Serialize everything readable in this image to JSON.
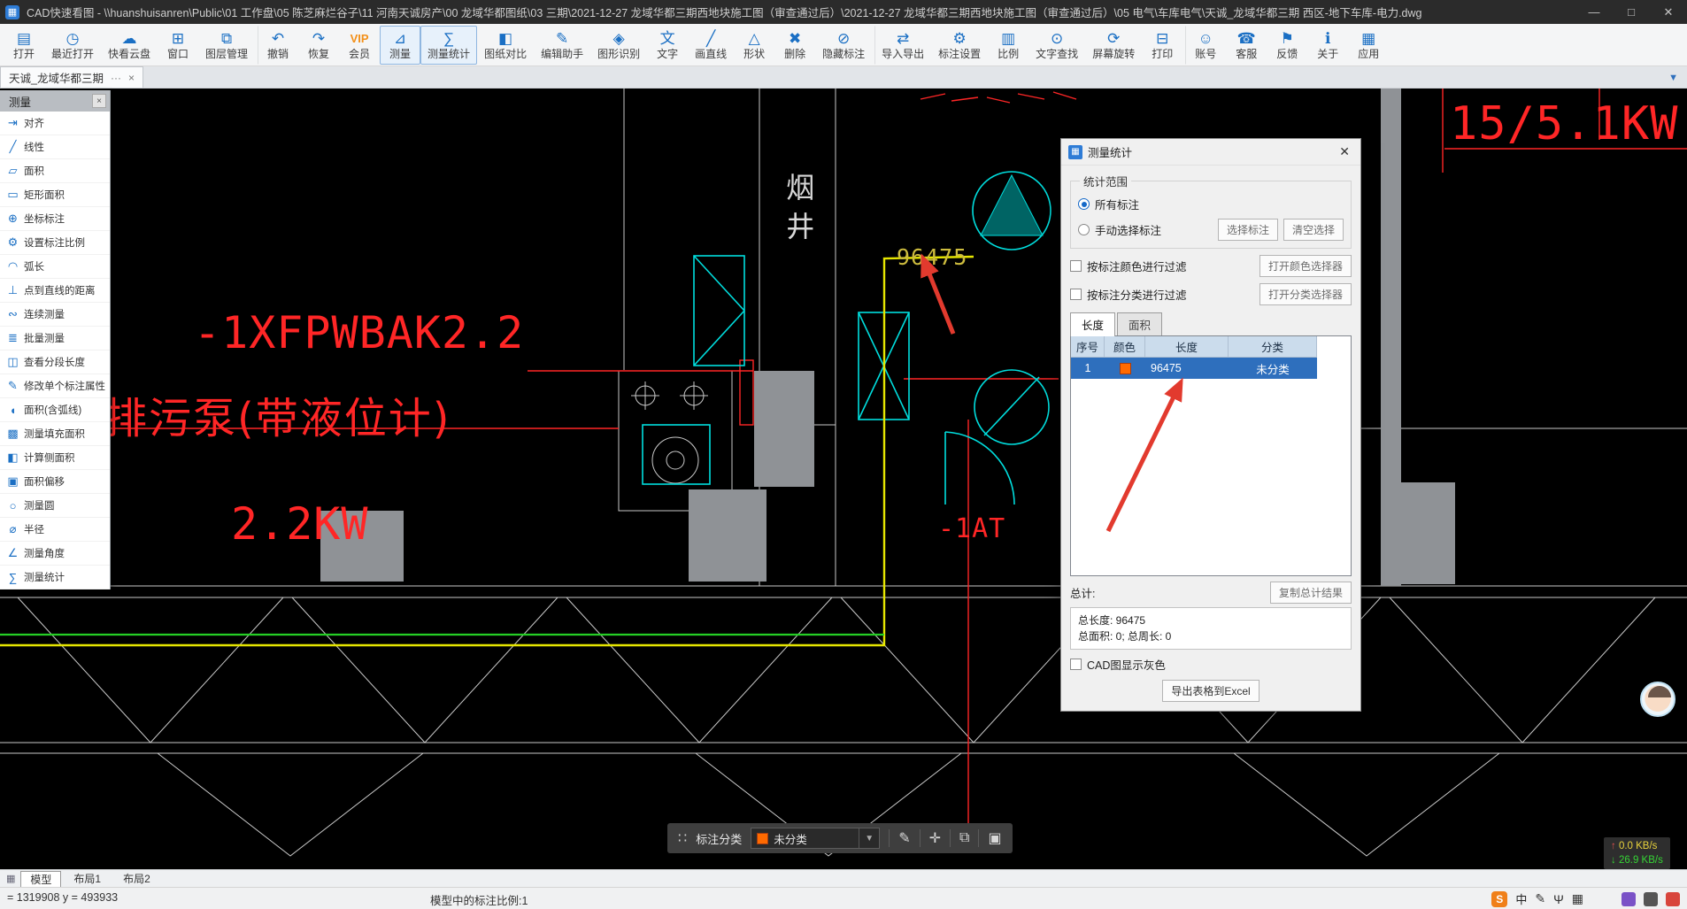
{
  "colors": {
    "titlebar-bg": "#2b2b2b",
    "toolbar-icon": "#1a6fc4",
    "accent": "#2e6fbd",
    "selected-row": "#2e6fbd",
    "swatch-orange": "#ff6a00",
    "cad-red": "#ff2626",
    "cad-cyan": "#00dede",
    "cad-yellow": "#e6e600",
    "cad-gold": "#cdbc3e",
    "cad-green": "#25cf25",
    "cad-white": "#c9c9c9",
    "cad-gray": "#8f9296",
    "arrow-red": "#e23a2e",
    "speed-up": "#e8d23c",
    "speed-down": "#35d435"
  },
  "titlebar": {
    "app_icon": "▦",
    "title": "CAD快速看图 - \\\\huanshuisanren\\Public\\01 工作盘\\05 陈芝麻烂谷子\\11 河南天诚房产\\00 龙域华都图纸\\03 三期\\2021-12-27 龙域华都三期西地块施工图（审查通过后）\\2021-12-27 龙域华都三期西地块施工图（审查通过后）\\05 电气\\车库电气\\天诚_龙域华都三期 西区-地下车库-电力.dwg",
    "minimize_icon": "—",
    "maximize_icon": "□",
    "close_icon": "✕"
  },
  "toolbar": {
    "items": [
      {
        "name": "open-button",
        "icon_name": "folder-open-icon",
        "icon": "▤",
        "label": "打开"
      },
      {
        "name": "recent-open-button",
        "icon_name": "recent-clock-icon",
        "icon": "◷",
        "label": "最近打开"
      },
      {
        "name": "cloud-drive-button",
        "icon_name": "cloud-icon",
        "icon": "☁",
        "label": "快看云盘"
      },
      {
        "name": "window-button",
        "icon_name": "window-icon",
        "icon": "⊞",
        "label": "窗口"
      },
      {
        "name": "layer-manager-button",
        "icon_name": "layers-icon",
        "icon": "⧉",
        "label": "图层管理"
      },
      {
        "name": "undo-button",
        "icon_name": "undo-icon",
        "icon": "↶",
        "label": "撤销",
        "sep": true
      },
      {
        "name": "redo-button",
        "icon_name": "redo-icon",
        "icon": "↷",
        "label": "恢复"
      },
      {
        "name": "vip-member-button",
        "icon_name": "vip-icon",
        "icon": "VIP",
        "label": "会员",
        "vip": true
      },
      {
        "name": "measure-button",
        "icon_name": "measure-icon",
        "icon": "⊿",
        "label": "测量",
        "active": true
      },
      {
        "name": "measure-stats-button",
        "icon_name": "stats-icon",
        "icon": "∑",
        "label": "测量统计",
        "active": true
      },
      {
        "name": "drawing-compare-button",
        "icon_name": "compare-icon",
        "icon": "◧",
        "label": "图纸对比"
      },
      {
        "name": "edit-assistant-button",
        "icon_name": "edit-assistant-icon",
        "icon": "✎",
        "label": "编辑助手"
      },
      {
        "name": "shape-recognition-button",
        "icon_name": "recognize-icon",
        "icon": "◈",
        "label": "图形识别"
      },
      {
        "name": "text-button",
        "icon_name": "text-icon",
        "icon": "文",
        "label": "文字"
      },
      {
        "name": "draw-line-button",
        "icon_name": "line-icon",
        "icon": "╱",
        "label": "画直线"
      },
      {
        "name": "shapes-button",
        "icon_name": "shapes-icon",
        "icon": "△",
        "label": "形状"
      },
      {
        "name": "delete-button",
        "icon_name": "delete-icon",
        "icon": "✖",
        "label": "删除"
      },
      {
        "name": "hide-annotations-button",
        "icon_name": "hide-annotation-icon",
        "icon": "⊘",
        "label": "隐藏标注"
      },
      {
        "name": "import-export-button",
        "icon_name": "import-export-icon",
        "icon": "⇄",
        "label": "导入导出",
        "sep": true
      },
      {
        "name": "annotation-settings-button",
        "icon_name": "settings-gear-icon",
        "icon": "⚙",
        "label": "标注设置"
      },
      {
        "name": "scale-button",
        "icon_name": "scale-icon",
        "icon": "▥",
        "label": "比例"
      },
      {
        "name": "text-search-button",
        "icon_name": "search-icon",
        "icon": "⊙",
        "label": "文字查找"
      },
      {
        "name": "screen-rotate-button",
        "icon_name": "rotate-icon",
        "icon": "⟳",
        "label": "屏幕旋转"
      },
      {
        "name": "print-button",
        "icon_name": "print-icon",
        "icon": "⊟",
        "label": "打印"
      },
      {
        "name": "account-button",
        "icon_name": "user-icon",
        "icon": "☺",
        "label": "账号",
        "sep": true
      },
      {
        "name": "customer-service-button",
        "icon_name": "headset-icon",
        "icon": "☎",
        "label": "客服"
      },
      {
        "name": "feedback-button",
        "icon_name": "flag-icon",
        "icon": "⚑",
        "label": "反馈"
      },
      {
        "name": "about-button",
        "icon_name": "info-icon",
        "icon": "ℹ",
        "label": "关于"
      },
      {
        "name": "apps-button",
        "icon_name": "apps-grid-icon",
        "icon": "▦",
        "label": "应用"
      }
    ]
  },
  "tabbar": {
    "label": "天诚_龙域华都三期",
    "more_icon": "···",
    "close_icon": "×",
    "collapse_icon": "▼"
  },
  "sidebar": {
    "title": "测量",
    "close_icon": "×",
    "items": [
      {
        "name": "sidebar-item-align",
        "icon_name": "align-icon",
        "icon": "⇥",
        "label": "对齐"
      },
      {
        "name": "sidebar-item-linear",
        "icon_name": "linear-icon",
        "icon": "╱",
        "label": "线性"
      },
      {
        "name": "sidebar-item-area",
        "icon_name": "area-icon",
        "icon": "▱",
        "label": "面积"
      },
      {
        "name": "sidebar-item-rect-area",
        "icon_name": "rect-area-icon",
        "icon": "▭",
        "label": "矩形面积"
      },
      {
        "name": "sidebar-item-coordinate",
        "icon_name": "coordinate-icon",
        "icon": "⊕",
        "label": "坐标标注"
      },
      {
        "name": "sidebar-item-annotation-scale",
        "icon_name": "scale-settings-icon",
        "icon": "⚙",
        "label": "设置标注比例"
      },
      {
        "name": "sidebar-item-arc-length",
        "icon_name": "arc-icon",
        "icon": "◠",
        "label": "弧长"
      },
      {
        "name": "sidebar-item-point-line-distance",
        "icon_name": "perpendicular-icon",
        "icon": "⊥",
        "label": "点到直线的距离"
      },
      {
        "name": "sidebar-item-continuous-measure",
        "icon_name": "continuous-icon",
        "icon": "∾",
        "label": "连续测量"
      },
      {
        "name": "sidebar-item-batch-measure",
        "icon_name": "batch-icon",
        "icon": "≣",
        "label": "批量测量"
      },
      {
        "name": "sidebar-item-segment-length",
        "icon_name": "segment-icon",
        "icon": "◫",
        "label": "查看分段长度"
      },
      {
        "name": "sidebar-item-edit-annotation",
        "icon_name": "edit-property-icon",
        "icon": "✎",
        "label": "修改单个标注属性"
      },
      {
        "name": "sidebar-item-area-with-arc",
        "icon_name": "arc-area-icon",
        "icon": "◖",
        "label": "面积(含弧线)"
      },
      {
        "name": "sidebar-item-fill-area",
        "icon_name": "fill-area-icon",
        "icon": "▩",
        "label": "测量填充面积"
      },
      {
        "name": "sidebar-item-side-area",
        "icon_name": "side-area-icon",
        "icon": "◧",
        "label": "计算侧面积"
      },
      {
        "name": "sidebar-item-area-offset",
        "icon_name": "offset-icon",
        "icon": "▣",
        "label": "面积偏移"
      },
      {
        "name": "sidebar-item-measure-circle",
        "icon_name": "circle-icon",
        "icon": "○",
        "label": "测量圆"
      },
      {
        "name": "sidebar-item-radius",
        "icon_name": "radius-icon",
        "icon": "⌀",
        "label": "半径"
      },
      {
        "name": "sidebar-item-measure-angle",
        "icon_name": "angle-icon",
        "icon": "∠",
        "label": "测量角度"
      },
      {
        "name": "sidebar-item-measure-stats",
        "icon_name": "stats-icon",
        "icon": "∑",
        "label": "测量统计"
      }
    ]
  },
  "dialog": {
    "icon": "▦",
    "title": "测量统计",
    "close_icon": "✕",
    "range_label": "统计范围",
    "radio_all": "所有标注",
    "radio_manual": "手动选择标注",
    "btn_select": "选择标注",
    "btn_clear": "清空选择",
    "chk_color_filter": "按标注颜色进行过滤",
    "btn_color_picker": "打开颜色选择器",
    "chk_class_filter": "按标注分类进行过滤",
    "btn_class_picker": "打开分类选择器",
    "tab_length": "长度",
    "tab_area": "面积",
    "table": {
      "headers": [
        "序号",
        "颜色",
        "长度",
        "分类"
      ],
      "rows": [
        {
          "index": "1",
          "color": "#ff6a00",
          "length": "96475",
          "category": "未分类"
        }
      ]
    },
    "total_label": "总计:",
    "btn_copy_total": "复制总计结果",
    "total_length": "总长度: 96475",
    "total_area": "总面积: 0; 总周长: 0",
    "chk_gray": "CAD图显示灰色",
    "btn_export": "导出表格到Excel"
  },
  "canvas": {
    "labels": {
      "device": "-1XFPWBAK2.2",
      "pump": "排污泵(带液位计)",
      "power": "2.2KW",
      "dimension": "96475",
      "shaft": "烟井",
      "power2": "15/5.1KW",
      "circuit": "-1AT"
    },
    "bottom_toolbar": {
      "grid_icon": "∷",
      "label": "标注分类",
      "value": "未分类",
      "caret_icon": "▼",
      "edit_icon": "✎",
      "move_icon": "✛",
      "copy_icon": "⧉",
      "paste_icon": "▣"
    },
    "speed": {
      "up_icon": "↑",
      "up": "0.0 KB/s",
      "down_icon": "↓",
      "down": "26.9 KB/s"
    }
  },
  "bottom_tabs": {
    "grid_icon": "▦",
    "items": [
      {
        "name": "tab-model",
        "label": "模型",
        "active": true
      },
      {
        "name": "tab-layout1",
        "label": "布局1"
      },
      {
        "name": "tab-layout2",
        "label": "布局2"
      }
    ]
  },
  "statusbar": {
    "coords": "= 1319908 y = 493933",
    "scale": "模型中的标注比例:1",
    "tray": {
      "sogou": "S",
      "lang": "中",
      "pen_icon": "✎",
      "mic_icon": "Ψ",
      "keyboard_icon": "▦"
    }
  }
}
